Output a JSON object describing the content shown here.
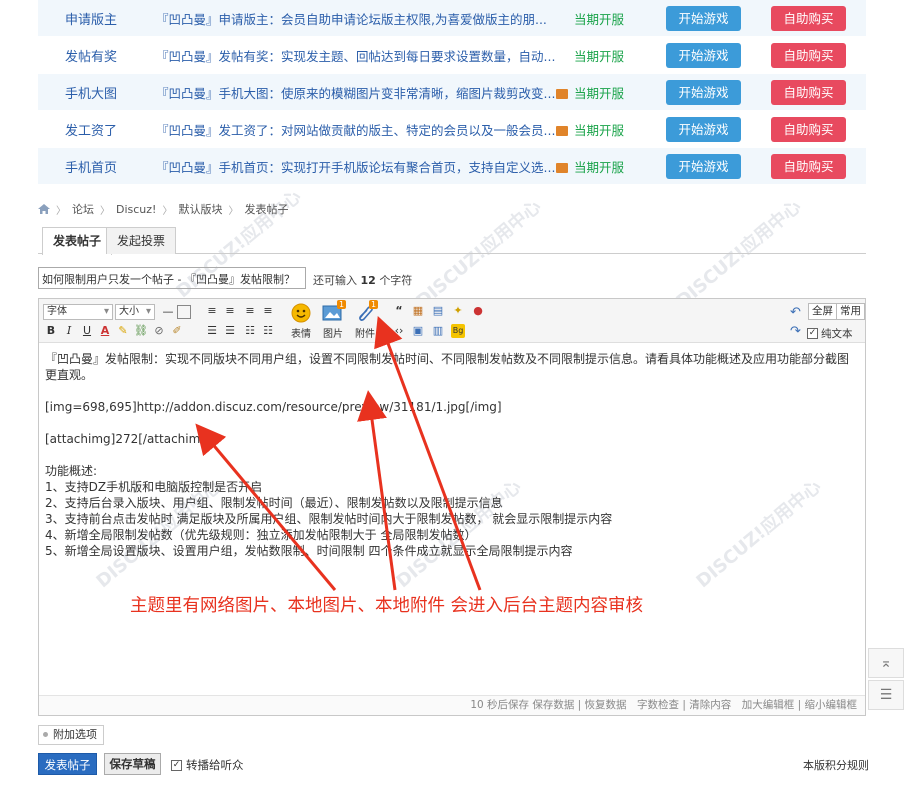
{
  "plugin_rows": [
    {
      "name": "申请版主",
      "desc": "『凹凸曼』申请版主：会员自助申请论坛版主权限,为喜爱做版主的朋...",
      "status": "当期开服",
      "play": "开始游戏",
      "buy": "自助购买",
      "gift": false
    },
    {
      "name": "发帖有奖",
      "desc": "『凹凸曼』发帖有奖：实现发主题、回帖达到每日要求设置数量，自动...",
      "status": "当期开服",
      "play": "开始游戏",
      "buy": "自助购买",
      "gift": false
    },
    {
      "name": "手机大图",
      "desc": "『凹凸曼』手机大图：使原来的模糊图片变非常清晰，缩图片裁剪改变...",
      "status": "当期开服",
      "play": "开始游戏",
      "buy": "自助购买",
      "gift": true
    },
    {
      "name": "发工资了",
      "desc": "『凹凸曼』发工资了：对网站做贡献的版主、特定的会员以及一般会员...",
      "status": "当期开服",
      "play": "开始游戏",
      "buy": "自助购买",
      "gift": true
    },
    {
      "name": "手机首页",
      "desc": "『凹凸曼』手机首页：实现打开手机版论坛有聚合首页，支持自定义选...",
      "status": "当期开服",
      "play": "开始游戏",
      "buy": "自助购买",
      "gift": true
    }
  ],
  "breadcrumb": [
    "论坛",
    "Discuz!",
    "默认版块",
    "发表帖子"
  ],
  "tabs": [
    "发表帖子",
    "发起投票"
  ],
  "title_input": {
    "value": "如何限制用户只发一个帖子 - 『凹凸曼』发帖限制？"
  },
  "counter": {
    "prefix": "还可输入",
    "count": "12",
    "suffix": "个字符"
  },
  "toolbar": {
    "font": "字体",
    "size": "大小",
    "emoji": "表情",
    "image": "图片",
    "attach": "附件",
    "fullscreen": "全屏",
    "common": "常用",
    "plain_text": "纯文本",
    "bold": "B",
    "italic": "I",
    "underline": "U",
    "fore_color": "A",
    "badge_image": "1",
    "badge_attach": "1",
    "bg_icon": "Bg"
  },
  "content_lines": [
    "『凹凸曼』发帖限制：实现不同版块不同用户组，设置不同限制发帖时间、不同限制发帖数及不同限制提示信息。请看具体功能概述及应用功能部分截图更直观。",
    "",
    "[img=698,695]http://addon.discuz.com/resource/preview/31181/1.jpg[/img]",
    "",
    "[attachimg]272[/attachimg]",
    "",
    "功能概述:",
    "1、支持DZ手机版和电脑版控制是否开启",
    "2、支持后台录入版块、用户组、限制发帖时间（最近）、限制发帖数以及限制提示信息",
    "3、支持前台点击发帖时 满足版块及所属用户组、限制发帖时间内大于限制发帖数， 就会显示限制提示内容",
    "4、新增全局限制发帖数（优先级规则：独立添加发帖限制大于 全局限制发帖数）",
    "5、新增全局设置版块、设置用户组，发帖数限制、时间限制 四个条件成立就显示全局限制提示内容"
  ],
  "editor_status": "10 秒后保存 保存数据 | 恢复数据　字数检查 | 清除内容　加大编辑框 | 缩小编辑框",
  "annotation": "主题里有网络图片、本地图片、本地附件 会进入后台主题内容审核",
  "attach_option": "附加选项",
  "submit": "发表帖子",
  "draft": "保存草稿",
  "repost": "转播给听众",
  "rules": "本版积分规则",
  "colors": {
    "link": "#2b5eaa",
    "status_green": "#1aa34a",
    "play_blue": "#3c9bd9",
    "buy_red": "#e84a5f",
    "annotation_red": "#e8321f",
    "submit_blue": "#2a6cc0"
  },
  "icons": [
    "home-icon",
    "gift-icon",
    "emoji-icon",
    "image-icon",
    "attach-icon",
    "back-to-top-icon",
    "list-icon"
  ]
}
